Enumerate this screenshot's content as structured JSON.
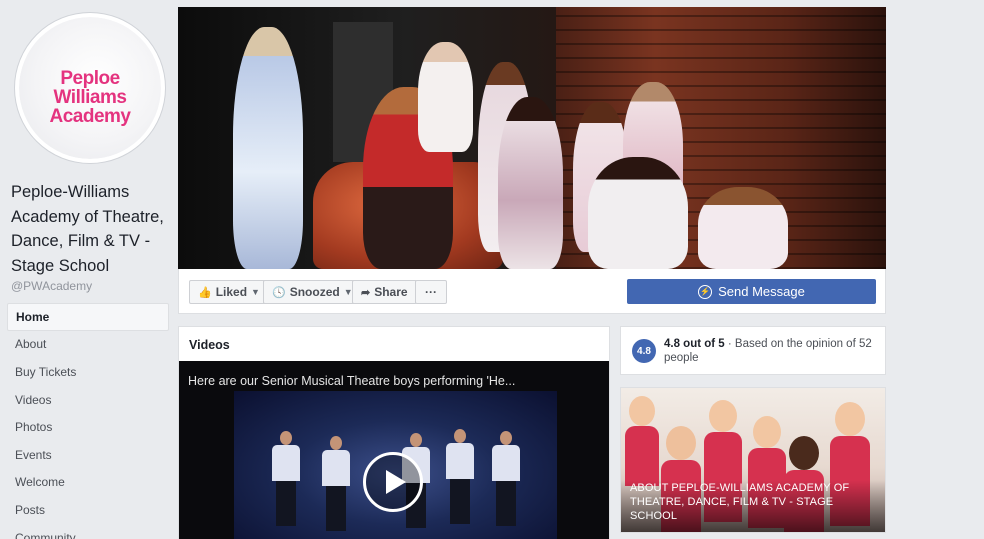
{
  "avatar": {
    "logo_lines": [
      "Peploe",
      "Williams",
      "Academy"
    ]
  },
  "page": {
    "name": "Peploe-Williams Academy of Theatre, Dance, Film & TV - Stage School",
    "handle": "@PWAcademy"
  },
  "nav": {
    "items": [
      {
        "label": "Home",
        "active": true
      },
      {
        "label": "About"
      },
      {
        "label": "Buy Tickets"
      },
      {
        "label": "Videos"
      },
      {
        "label": "Photos"
      },
      {
        "label": "Events"
      },
      {
        "label": "Welcome"
      },
      {
        "label": "Posts"
      },
      {
        "label": "Community"
      }
    ]
  },
  "actions": {
    "liked_label": "Liked",
    "snoozed_label": "Snoozed",
    "share_label": "Share",
    "more_label": "···",
    "send_message_label": "Send Message"
  },
  "videos": {
    "title": "Videos",
    "caption": "Here are our Senior Musical Theatre boys performing 'He..."
  },
  "rating": {
    "badge": "4.8",
    "score_text": "4.8 out of 5",
    "detail_text": " · Based on the opinion of 52 people"
  },
  "about": {
    "text": "About Peploe-Williams Academy of Theatre, Dance, Film & TV - Stage School"
  },
  "colors": {
    "brand_blue": "#4267b2",
    "logo_pink": "#e4337f",
    "page_bg": "#e9ebee"
  }
}
